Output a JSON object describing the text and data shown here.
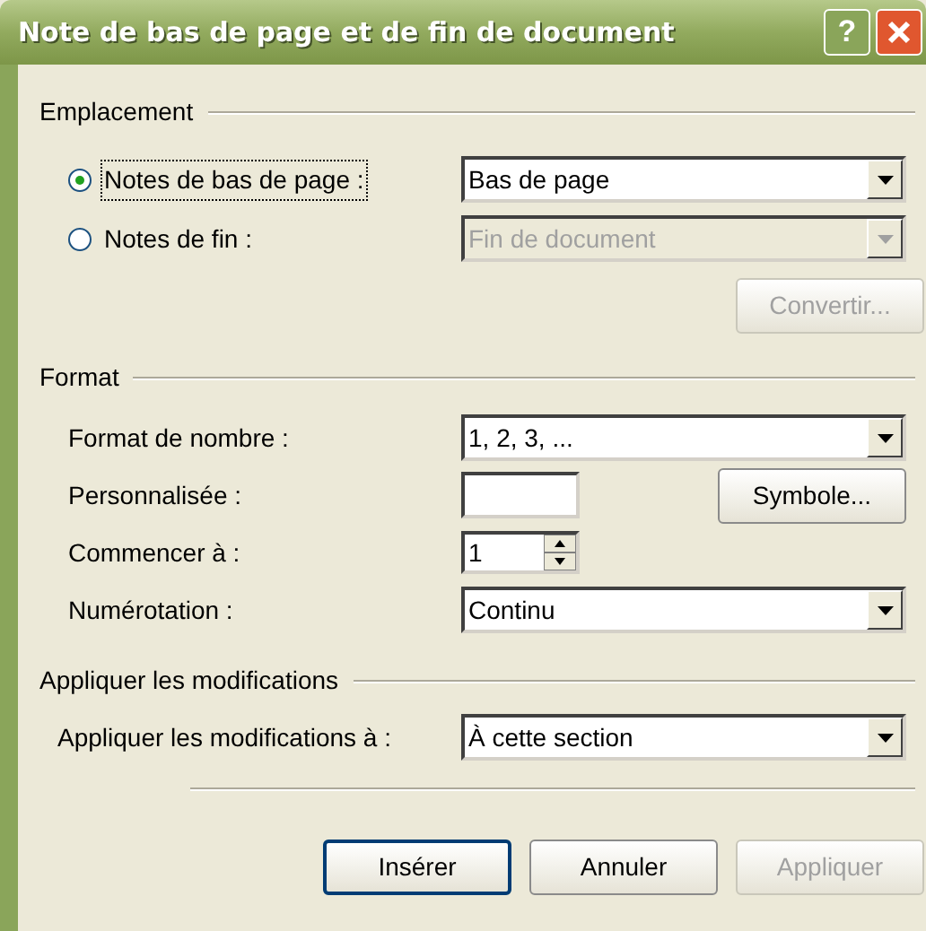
{
  "window": {
    "title": "Note de bas de page et de fin de document",
    "help_button": "?"
  },
  "location": {
    "legend": "Emplacement",
    "options": [
      {
        "label": "Notes de bas de page :",
        "selected": true,
        "dropdown": {
          "value": "Bas de page",
          "disabled": false
        }
      },
      {
        "label": "Notes de fin :",
        "selected": false,
        "dropdown": {
          "value": "Fin de document",
          "disabled": true
        }
      }
    ],
    "convert_button": {
      "label": "Convertir...",
      "disabled": true
    }
  },
  "format": {
    "legend": "Format",
    "fields": [
      {
        "kind": "dropdown",
        "label": "Format de nombre :",
        "value": "1, 2, 3, ..."
      },
      {
        "kind": "text",
        "label": "Personnalisée :",
        "button": "Symbole..."
      },
      {
        "kind": "spinner",
        "label": "Commencer à :",
        "value": "1"
      },
      {
        "kind": "dropdown",
        "label": "Numérotation :",
        "value": "Continu"
      }
    ]
  },
  "apply": {
    "legend": "Appliquer les modifications",
    "label": "Appliquer les modifications à :",
    "value": "À cette section"
  },
  "buttons": [
    {
      "label": "Insérer",
      "default": true,
      "disabled": false
    },
    {
      "label": "Annuler",
      "default": false,
      "disabled": false
    },
    {
      "label": "Appliquer",
      "default": false,
      "disabled": true
    }
  ]
}
